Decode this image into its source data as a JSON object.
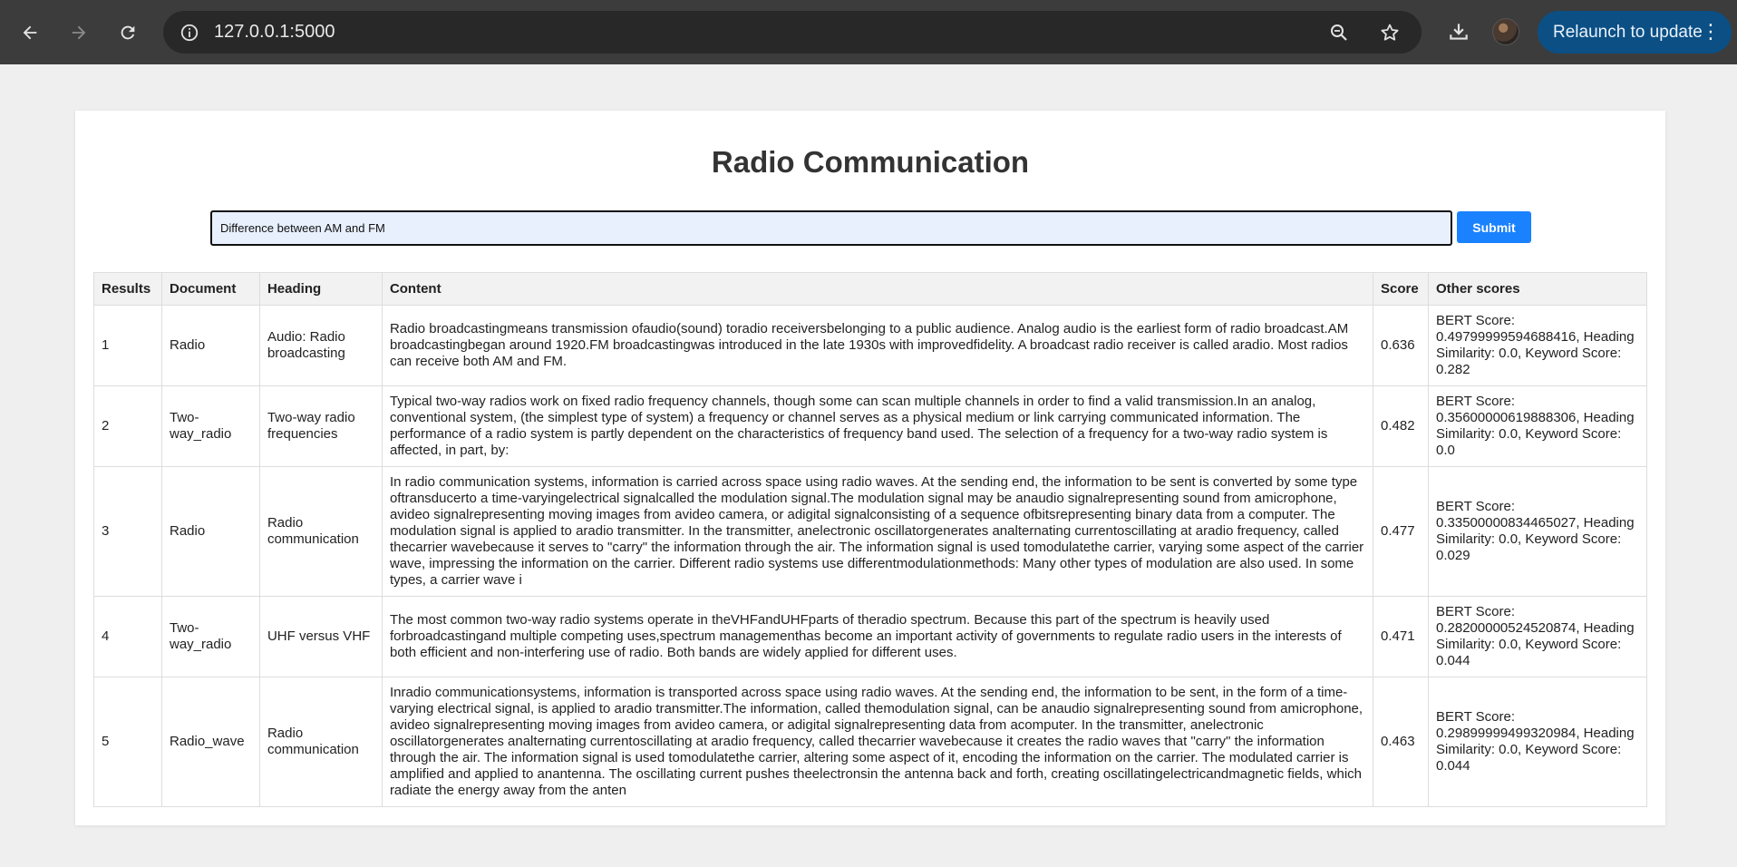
{
  "browser": {
    "url": "127.0.0.1:5000",
    "relaunch_label": "Relaunch to update"
  },
  "page": {
    "title": "Radio Communication",
    "query_value": "Difference between AM and FM",
    "submit_label": "Submit"
  },
  "table": {
    "headers": [
      "Results",
      "Document",
      "Heading",
      "Content",
      "Score",
      "Other scores"
    ],
    "rows": [
      {
        "result": "1",
        "document": "Radio",
        "heading": "Audio: Radio broadcasting",
        "content": "Radio broadcastingmeans transmission ofaudio(sound) toradio receiversbelonging to a public audience. Analog audio is the earliest form of radio broadcast.AM broadcastingbegan around 1920.FM broadcastingwas introduced in the late 1930s with improvedfidelity. A broadcast radio receiver is called aradio. Most radios can receive both AM and FM.",
        "score": "0.636",
        "other": "BERT Score: 0.49799999594688416, Heading Similarity: 0.0, Keyword Score: 0.282"
      },
      {
        "result": "2",
        "document": "Two-way_radio",
        "heading": "Two-way radio frequencies",
        "content": "Typical two-way radios work on fixed radio frequency channels, though some can scan multiple channels in order to find a valid transmission.In an analog, conventional system, (the simplest type of system) a frequency or channel serves as a physical medium or link carrying communicated information. The performance of a radio system is partly dependent on the characteristics of frequency band used. The selection of a frequency for a two-way radio system is affected, in part, by:",
        "score": "0.482",
        "other": "BERT Score: 0.35600000619888306, Heading Similarity: 0.0, Keyword Score: 0.0"
      },
      {
        "result": "3",
        "document": "Radio",
        "heading": "Radio communication",
        "content": "In radio communication systems, information is carried across space using radio waves. At the sending end, the information to be sent is converted by some type oftransducerto a time-varyingelectrical signalcalled the modulation signal.The modulation signal may be anaudio signalrepresenting sound from amicrophone, avideo signalrepresenting moving images from avideo camera, or adigital signalconsisting of a sequence ofbitsrepresenting binary data from a computer. The modulation signal is applied to aradio transmitter. In the transmitter, anelectronic oscillatorgenerates analternating currentoscillating at aradio frequency, called thecarrier wavebecause it serves to \"carry\" the information through the air. The information signal is used tomodulatethe carrier, varying some aspect of the carrier wave, impressing the information on the carrier. Different radio systems use differentmodulationmethods: Many other types of modulation are also used. In some types, a carrier wave i",
        "score": "0.477",
        "other": "BERT Score: 0.33500000834465027, Heading Similarity: 0.0, Keyword Score: 0.029"
      },
      {
        "result": "4",
        "document": "Two-way_radio",
        "heading": "UHF versus VHF",
        "content": "The most common two-way radio systems operate in theVHFandUHFparts of theradio spectrum. Because this part of the spectrum is heavily used forbroadcastingand multiple competing uses,spectrum managementhas become an important activity of governments to regulate radio users in the interests of both efficient and non-interfering use of radio. Both bands are widely applied for different uses.",
        "score": "0.471",
        "other": "BERT Score: 0.28200000524520874, Heading Similarity: 0.0, Keyword Score: 0.044"
      },
      {
        "result": "5",
        "document": "Radio_wave",
        "heading": "Radio communication",
        "content": "Inradio communicationsystems, information is transported across space using radio waves. At the sending end, the information to be sent, in the form of a time-varying electrical signal, is applied to aradio transmitter.The information, called themodulation signal, can be anaudio signalrepresenting sound from amicrophone, avideo signalrepresenting moving images from avideo camera, or adigital signalrepresenting data from acomputer. In the transmitter, anelectronic oscillatorgenerates analternating currentoscillating at aradio frequency, called thecarrier wavebecause it creates the radio waves that \"carry\" the information through the air. The information signal is used tomodulatethe carrier, altering some aspect of it, encoding the information on the carrier. The modulated carrier is amplified and applied to anantenna. The oscillating current pushes theelectronsin the antenna back and forth, creating oscillatingelectricandmagnetic fields, which radiate the energy away from the anten",
        "score": "0.463",
        "other": "BERT Score: 0.29899999499320984, Heading Similarity: 0.0, Keyword Score: 0.044"
      }
    ]
  }
}
